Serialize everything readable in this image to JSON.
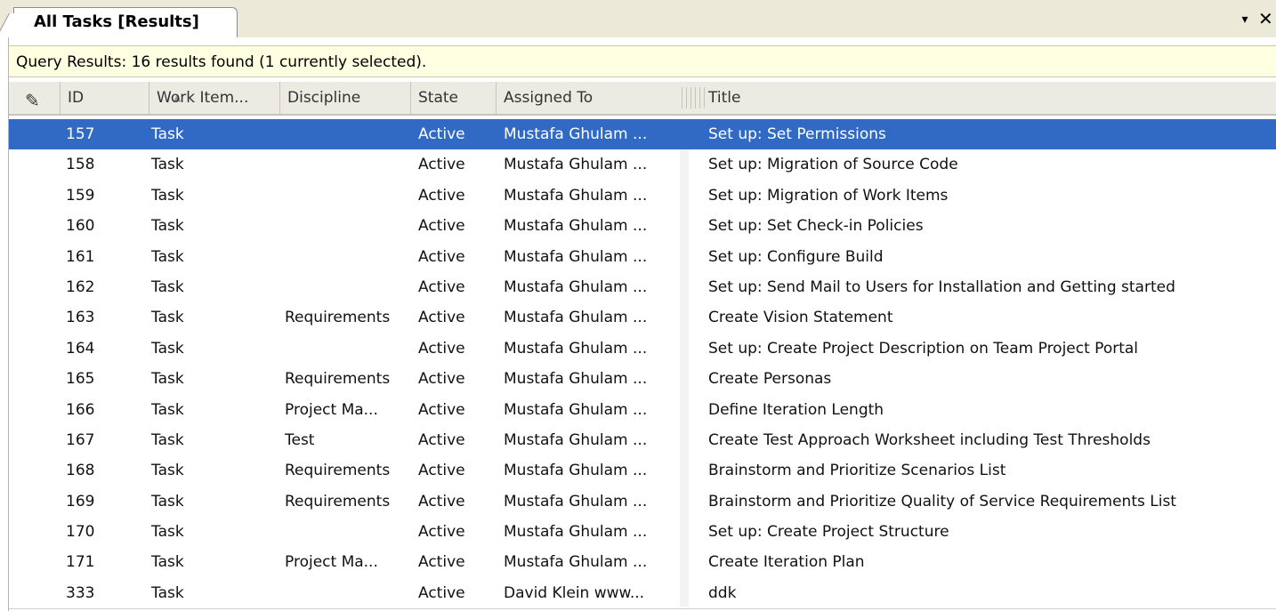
{
  "tab": {
    "title": "All Tasks [Results]"
  },
  "window_controls": {
    "dropdown": "▾",
    "close": "✕"
  },
  "info_bar": {
    "text": "Query Results: 16 results found (1 currently selected)."
  },
  "columns": [
    {
      "key": "edit",
      "label": ""
    },
    {
      "key": "id",
      "label": "ID"
    },
    {
      "key": "work_item_type",
      "label": "Work Item..."
    },
    {
      "key": "discipline",
      "label": "Discipline"
    },
    {
      "key": "state",
      "label": "State"
    },
    {
      "key": "assigned_to",
      "label": "Assigned To"
    },
    {
      "key": "title",
      "label": "Title"
    }
  ],
  "rows": [
    {
      "id": "157",
      "type": "Task",
      "discipline": "",
      "state": "Active",
      "assigned_to": "Mustafa Ghulam ...",
      "title": "Set up: Set Permissions",
      "selected": true
    },
    {
      "id": "158",
      "type": "Task",
      "discipline": "",
      "state": "Active",
      "assigned_to": "Mustafa Ghulam ...",
      "title": "Set up: Migration of Source Code"
    },
    {
      "id": "159",
      "type": "Task",
      "discipline": "",
      "state": "Active",
      "assigned_to": "Mustafa Ghulam ...",
      "title": "Set up: Migration of Work Items"
    },
    {
      "id": "160",
      "type": "Task",
      "discipline": "",
      "state": "Active",
      "assigned_to": "Mustafa Ghulam ...",
      "title": "Set up: Set Check-in Policies"
    },
    {
      "id": "161",
      "type": "Task",
      "discipline": "",
      "state": "Active",
      "assigned_to": "Mustafa Ghulam ...",
      "title": "Set up: Configure Build"
    },
    {
      "id": "162",
      "type": "Task",
      "discipline": "",
      "state": "Active",
      "assigned_to": "Mustafa Ghulam ...",
      "title": "Set up: Send Mail to Users for Installation and Getting started"
    },
    {
      "id": "163",
      "type": "Task",
      "discipline": "Requirements",
      "state": "Active",
      "assigned_to": "Mustafa Ghulam ...",
      "title": "Create Vision Statement"
    },
    {
      "id": "164",
      "type": "Task",
      "discipline": "",
      "state": "Active",
      "assigned_to": "Mustafa Ghulam ...",
      "title": "Set up: Create Project Description on Team Project Portal"
    },
    {
      "id": "165",
      "type": "Task",
      "discipline": "Requirements",
      "state": "Active",
      "assigned_to": "Mustafa Ghulam ...",
      "title": "Create Personas"
    },
    {
      "id": "166",
      "type": "Task",
      "discipline": "Project Ma...",
      "state": "Active",
      "assigned_to": "Mustafa Ghulam ...",
      "title": "Define Iteration Length"
    },
    {
      "id": "167",
      "type": "Task",
      "discipline": "Test",
      "state": "Active",
      "assigned_to": "Mustafa Ghulam ...",
      "title": "Create Test Approach Worksheet including Test Thresholds"
    },
    {
      "id": "168",
      "type": "Task",
      "discipline": "Requirements",
      "state": "Active",
      "assigned_to": "Mustafa Ghulam ...",
      "title": "Brainstorm and Prioritize Scenarios List"
    },
    {
      "id": "169",
      "type": "Task",
      "discipline": "Requirements",
      "state": "Active",
      "assigned_to": "Mustafa Ghulam ...",
      "title": "Brainstorm and Prioritize Quality of Service Requirements List"
    },
    {
      "id": "170",
      "type": "Task",
      "discipline": "",
      "state": "Active",
      "assigned_to": "Mustafa Ghulam ...",
      "title": "Set up: Create Project Structure"
    },
    {
      "id": "171",
      "type": "Task",
      "discipline": "Project Ma...",
      "state": "Active",
      "assigned_to": "Mustafa Ghulam ...",
      "title": "Create Iteration Plan"
    },
    {
      "id": "333",
      "type": "Task",
      "discipline": "",
      "state": "Active",
      "assigned_to": "David Klein www...",
      "title": "ddk"
    }
  ],
  "colors": {
    "selection": "#316ac5",
    "info_bar": "#ffffe1",
    "header": "#ebebe4",
    "chrome": "#ece9d8"
  }
}
